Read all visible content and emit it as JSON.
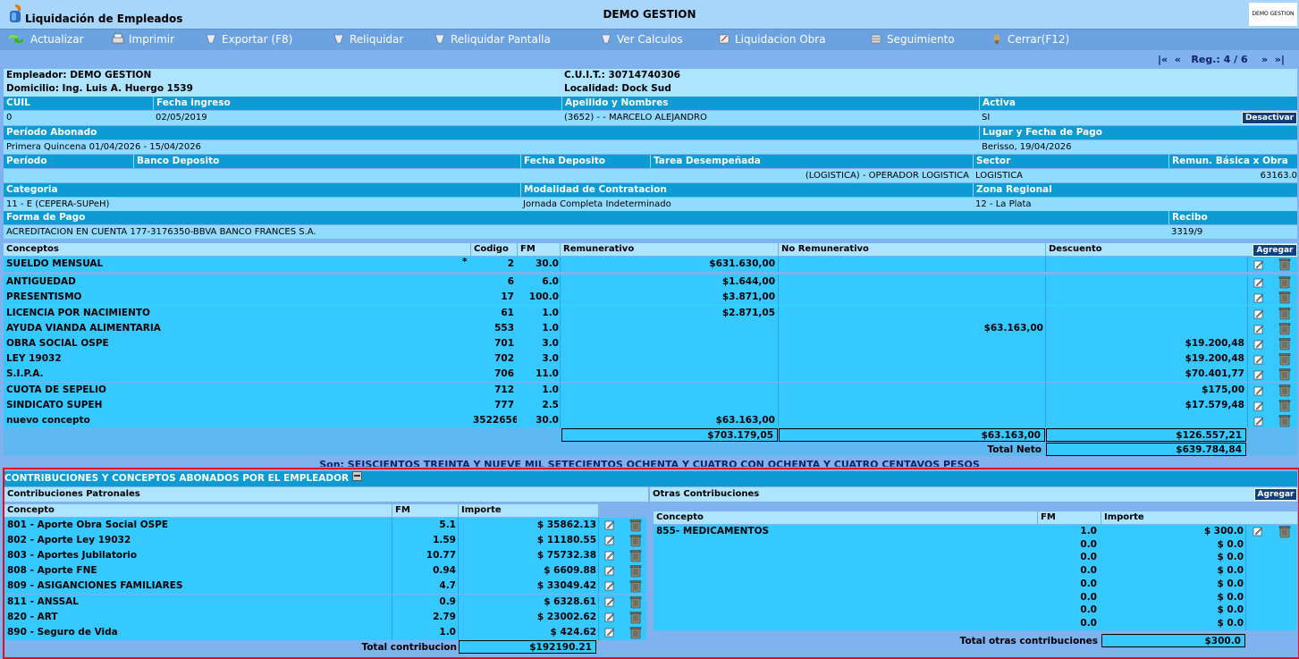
{
  "app": {
    "name": "Liquidación de Empleados",
    "company": "DEMO GESTION",
    "badge": "DEMO GESTION"
  },
  "toolbar": [
    {
      "label": "Actualizar",
      "icon": "refresh-icon"
    },
    {
      "label": "Imprimir",
      "icon": "print-icon"
    },
    {
      "label": "Exportar (F8)",
      "icon": "export-icon"
    },
    {
      "label": "Reliquidar",
      "icon": "reliquidar-icon"
    },
    {
      "label": "Reliquidar Pantalla",
      "icon": "reliquidar-pantalla-icon"
    },
    {
      "label": "Ver Calculos",
      "icon": "calculos-icon"
    },
    {
      "label": "Liquidacion Obra",
      "icon": "obra-icon"
    },
    {
      "label": "Seguimiento",
      "icon": "seguimiento-icon"
    },
    {
      "label": "Cerrar(F12)",
      "icon": "close-icon"
    }
  ],
  "nav": {
    "first": "|«",
    "prev": "«",
    "reg": "Reg.: 4 / 6",
    "next": "»",
    "last": "»|"
  },
  "employer": {
    "empleador": "Empleador: DEMO GESTION",
    "cuit": "C.U.I.T.: 30714740306",
    "domicilio": "Domicilio: Ing. Luis A. Huergo 1539",
    "localidad": "Localidad: Dock Sud"
  },
  "fields": {
    "cuil_label": "CUIL",
    "cuil": "0",
    "fecha_ingreso_label": "Fecha ingreso",
    "fecha_ingreso": "02/05/2019",
    "apellido_label": "Apellido y Nombres",
    "apellido": "(3652) - - MARCELO ALEJANDRO",
    "activa_label": "Activa",
    "activa": "SI",
    "desactivar": "Desactivar",
    "periodo_abonado_label": "Período Abonado",
    "periodo_abonado": "Primera Quincena 01/04/2026 - 15/04/2026",
    "lugar_label": "Lugar y Fecha de Pago",
    "lugar": "Berisso, 19/04/2026",
    "periodo_label": "Período",
    "banco_label": "Banco Deposito",
    "fecha_dep_label": "Fecha Deposito",
    "tarea_label": "Tarea Desempeñada",
    "tarea": "(LOGISTICA) - OPERADOR LOGISTICA",
    "sector_label": "Sector",
    "sector": "LOGISTICA",
    "remun_label": "Remun. Básica x Obra",
    "remun": "63163.0",
    "categoria_label": "Categoria",
    "categoria": "11 - E (CEPERA-SUPeH)",
    "modalidad_label": "Modalidad de Contratacion",
    "modalidad": "Jornada Completa Indeterminado",
    "zona_label": "Zona Regional",
    "zona": "12 - La Plata",
    "forma_label": "Forma de Pago",
    "forma": "ACREDITACION EN CUENTA 177-3176350-BBVA BANCO FRANCES S.A.",
    "recibo_label": "Recibo",
    "recibo": "3319/9"
  },
  "concepts": {
    "headers": {
      "concepto": "Conceptos",
      "codigo": "Codigo",
      "fm": "FM",
      "rem": "Remunerativo",
      "norem": "No Remunerativo",
      "desc": "Descuento",
      "agregar": "Agregar"
    },
    "rows": [
      {
        "concepto": "SUELDO MENSUAL",
        "mark": "*",
        "codigo": "2",
        "fm": "30.0",
        "rem": "$631.630,00",
        "norem": "",
        "desc": ""
      },
      {
        "concepto": "ANTIGUEDAD",
        "mark": "",
        "codigo": "6",
        "fm": "6.0",
        "rem": "$1.644,00",
        "norem": "",
        "desc": ""
      },
      {
        "concepto": "PRESENTISMO",
        "mark": "",
        "codigo": "17",
        "fm": "100.0",
        "rem": "$3.871,00",
        "norem": "",
        "desc": ""
      },
      {
        "concepto": "LICENCIA POR NACIMIENTO",
        "mark": "",
        "codigo": "61",
        "fm": "1.0",
        "rem": "$2.871,05",
        "norem": "",
        "desc": ""
      },
      {
        "concepto": "AYUDA VIANDA ALIMENTARIA",
        "mark": "",
        "codigo": "553",
        "fm": "1.0",
        "rem": "",
        "norem": "$63.163,00",
        "desc": ""
      },
      {
        "concepto": "OBRA SOCIAL OSPE",
        "mark": "",
        "codigo": "701",
        "fm": "3.0",
        "rem": "",
        "norem": "",
        "desc": "$19.200,48"
      },
      {
        "concepto": "LEY 19032",
        "mark": "",
        "codigo": "702",
        "fm": "3.0",
        "rem": "",
        "norem": "",
        "desc": "$19.200,48"
      },
      {
        "concepto": "S.I.P.A.",
        "mark": "",
        "codigo": "706",
        "fm": "11.0",
        "rem": "",
        "norem": "",
        "desc": "$70.401,77"
      },
      {
        "concepto": "CUOTA DE SEPELIO",
        "mark": "",
        "codigo": "712",
        "fm": "1.0",
        "rem": "",
        "norem": "",
        "desc": "$175,00"
      },
      {
        "concepto": "SINDICATO SUPEH",
        "mark": "",
        "codigo": "777",
        "fm": "2.5",
        "rem": "",
        "norem": "",
        "desc": "$17.579,48"
      },
      {
        "concepto": "nuevo concepto",
        "mark": "",
        "codigo": "3522656",
        "fm": "30.0",
        "rem": "$63.163,00",
        "norem": "",
        "desc": ""
      }
    ],
    "totals": {
      "rem": "$703.179,05",
      "norem": "$63.163,00",
      "desc": "$126.557,21",
      "neto_label": "Total Neto",
      "neto": "$639.784,84"
    },
    "son": "Son:  SEISCIENTOS TREINTA Y NUEVE MIL SETECIENTOS OCHENTA Y CUATRO CON OCHENTA Y CUATRO CENTAVOS   PESOS"
  },
  "employer_section": {
    "title": "CONTRIBUCIONES Y CONCEPTOS ABONADOS POR EL EMPLEADOR",
    "patronales_title": "Contribuciones Patronales",
    "otras_title": "Otras Contribuciones",
    "agregar": "Agregar",
    "headers": {
      "concepto": "Concepto",
      "fm": "FM",
      "importe": "Importe"
    },
    "patronales": [
      {
        "concepto": "801 - Aporte Obra Social OSPE",
        "fm": "5.1",
        "importe": "$ 35862.13"
      },
      {
        "concepto": "802 - Aporte Ley 19032",
        "fm": "1.59",
        "importe": "$ 11180.55"
      },
      {
        "concepto": "803 - Aportes Jubilatorio",
        "fm": "10.77",
        "importe": "$ 75732.38"
      },
      {
        "concepto": "808 - Aporte FNE",
        "fm": "0.94",
        "importe": "$ 6609.88"
      },
      {
        "concepto": "809 - ASIGANCIONES FAMILIARES",
        "fm": "4.7",
        "importe": "$ 33049.42"
      },
      {
        "concepto": "811 - ANSSAL",
        "fm": "0.9",
        "importe": "$ 6328.61"
      },
      {
        "concepto": "820 - ART",
        "fm": "2.79",
        "importe": "$ 23002.62"
      },
      {
        "concepto": "890 - Seguro de Vida",
        "fm": "1.0",
        "importe": "$ 424.62"
      }
    ],
    "total_contrib_label": "Total contribucion",
    "total_contrib": "$192190.21",
    "otras": [
      {
        "concepto": "855- MEDICAMENTOS",
        "fm": "1.0",
        "importe": "$ 300.0"
      },
      {
        "concepto": "",
        "fm": "0.0",
        "importe": "$ 0.0"
      },
      {
        "concepto": "",
        "fm": "0.0",
        "importe": "$ 0.0"
      },
      {
        "concepto": "",
        "fm": "0.0",
        "importe": "$ 0.0"
      },
      {
        "concepto": "",
        "fm": "0.0",
        "importe": "$ 0.0"
      },
      {
        "concepto": "",
        "fm": "0.0",
        "importe": "$ 0.0"
      },
      {
        "concepto": "",
        "fm": "0.0",
        "importe": "$ 0.0"
      },
      {
        "concepto": "",
        "fm": "0.0",
        "importe": "$ 0.0"
      }
    ],
    "total_otras_label": "Total otras contribuciones",
    "total_otras": "$300.0"
  }
}
